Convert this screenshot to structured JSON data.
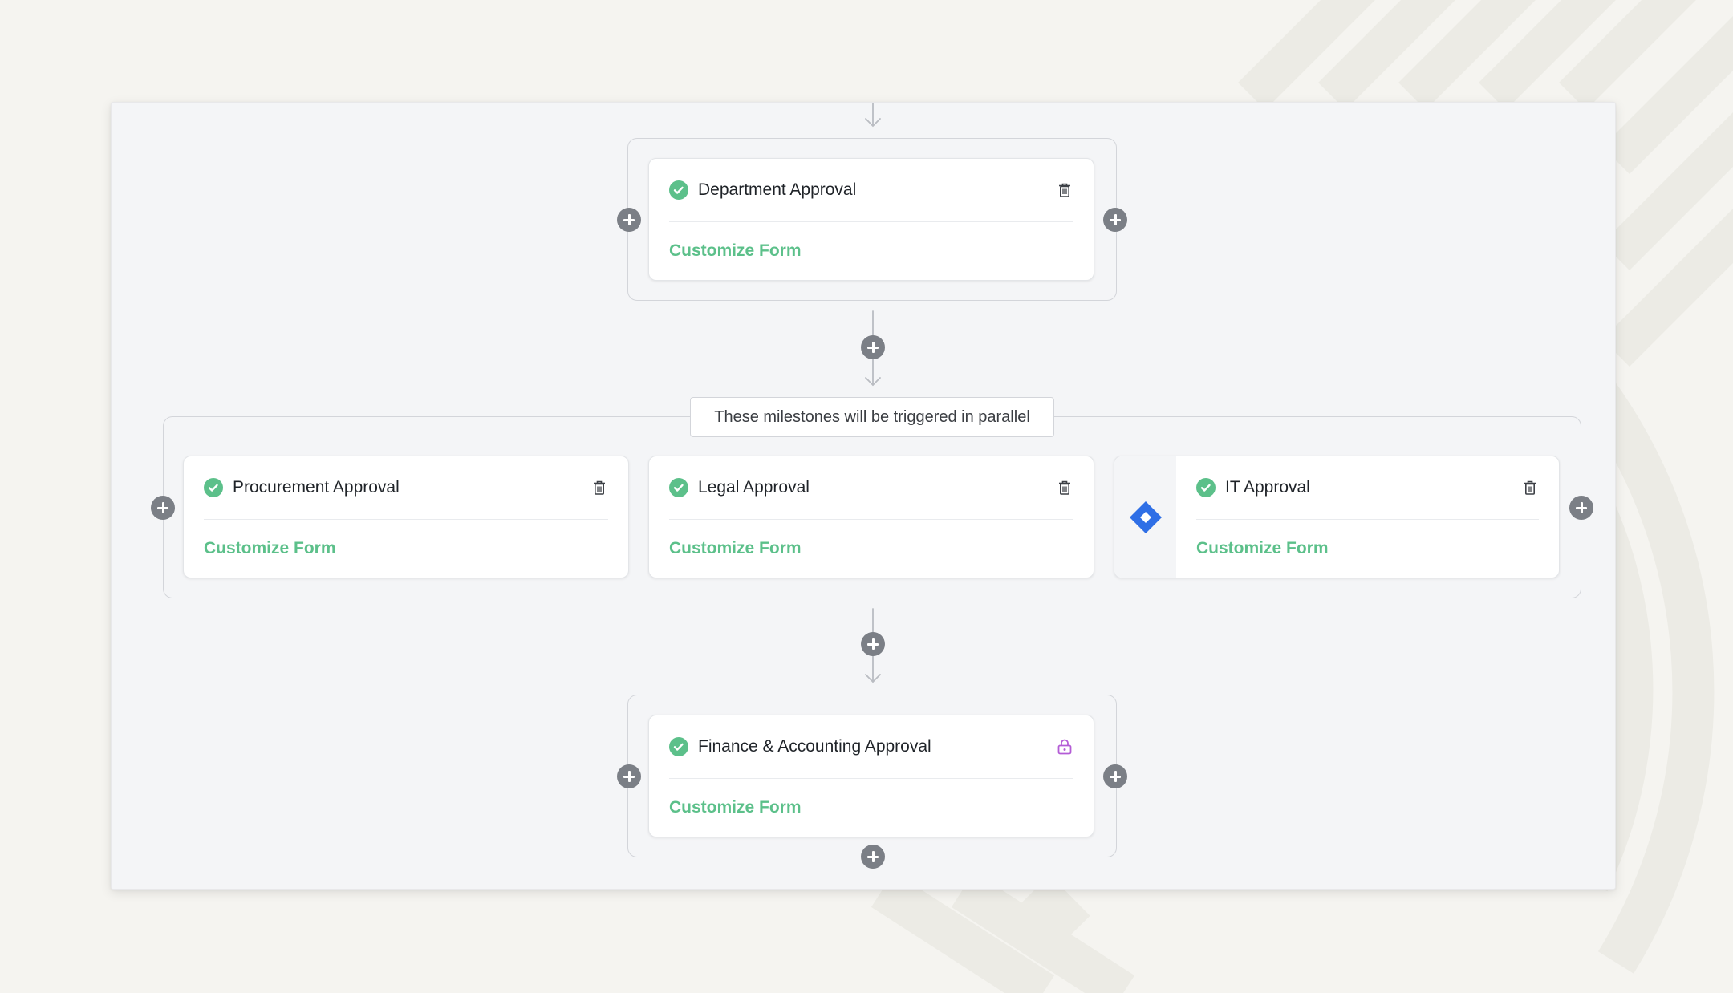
{
  "colors": {
    "accent_green": "#5cc08a",
    "plus_gray": "#7b7f86",
    "lock_purple": "#b45cd6",
    "jira_blue": "#2f6fe6"
  },
  "workflow": {
    "parallel_label": "These milestones will be triggered in parallel",
    "milestones": [
      {
        "title": "Department Approval",
        "link": "Customize Form",
        "status_icon": "check-circle-icon",
        "action_icon": "trash-icon"
      },
      {
        "title": "Procurement Approval",
        "link": "Customize Form",
        "status_icon": "check-circle-icon",
        "action_icon": "trash-icon"
      },
      {
        "title": "Legal Approval",
        "link": "Customize Form",
        "status_icon": "check-circle-icon",
        "action_icon": "trash-icon"
      },
      {
        "title": "IT Approval",
        "link": "Customize Form",
        "status_icon": "check-circle-icon",
        "action_icon": "trash-icon",
        "integration_icon": "jira-icon"
      },
      {
        "title": "Finance & Accounting Approval",
        "link": "Customize Form",
        "status_icon": "check-circle-icon",
        "action_icon": "lock-icon"
      }
    ]
  }
}
